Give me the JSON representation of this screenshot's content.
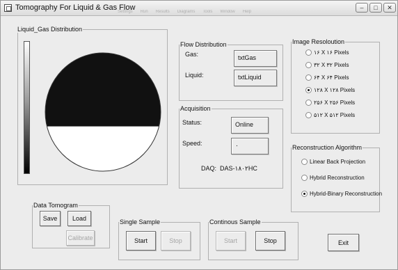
{
  "window": {
    "title": "Tomography For Liquid & Gas Flow",
    "menu_ghost": [
      "Settings",
      "Run",
      "Results",
      "Diagrams",
      "Tools",
      "Window",
      "Help"
    ],
    "controls": {
      "minimize": "–",
      "maximize": "□",
      "close": "✕"
    }
  },
  "distribution": {
    "label": "Liquid_Gas Distribution",
    "gas_fraction": 0.62,
    "gas_color": "#111111",
    "liquid_color": "#ffffff"
  },
  "flow_distribution": {
    "label": "Flow Distribution",
    "gas_label": "Gas:",
    "gas_value": "txtGas",
    "liquid_label": "Liquid:",
    "liquid_value": "txtLiquid"
  },
  "acquisition": {
    "label": "Acquisition",
    "status_label": "Status:",
    "status_value": "Online",
    "speed_label": "Speed:",
    "speed_value": "۰",
    "daq_label": "DAQ:",
    "daq_value": "DAS-۱۸۰۲HC"
  },
  "image_resolution": {
    "label": "Image Resoloution",
    "options": [
      {
        "label": "۱۶ X ۱۶ Pixels",
        "selected": false
      },
      {
        "label": "۳۲ X ۳۲ Pixels",
        "selected": false
      },
      {
        "label": "۶۴ X ۶۴ Pixels",
        "selected": false
      },
      {
        "label": "۱۲۸ X ۱۲۸ Pixels",
        "selected": true
      },
      {
        "label": "۲۵۶ X ۲۵۶ Pixels",
        "selected": false
      },
      {
        "label": "۵۱۲ X ۵۱۲ Pixels",
        "selected": false
      }
    ]
  },
  "reconstruction": {
    "label": "Reconstruction Algorithm",
    "options": [
      {
        "label": "Linear Back Projection",
        "selected": false
      },
      {
        "label": "Hybrid Reconstruction",
        "selected": false
      },
      {
        "label": "Hybrid-Binary Reconstruction",
        "selected": true
      }
    ]
  },
  "data_tomogram": {
    "label": "Data Tomogram",
    "save": "Save",
    "load": "Load",
    "calibrate": "Calibrate"
  },
  "single_sample": {
    "label": "Single Sample",
    "start": "Start",
    "stop": "Stop"
  },
  "continuous_sample": {
    "label": "Continous Sample",
    "start": "Start",
    "stop": "Stop"
  },
  "exit": "Exit"
}
